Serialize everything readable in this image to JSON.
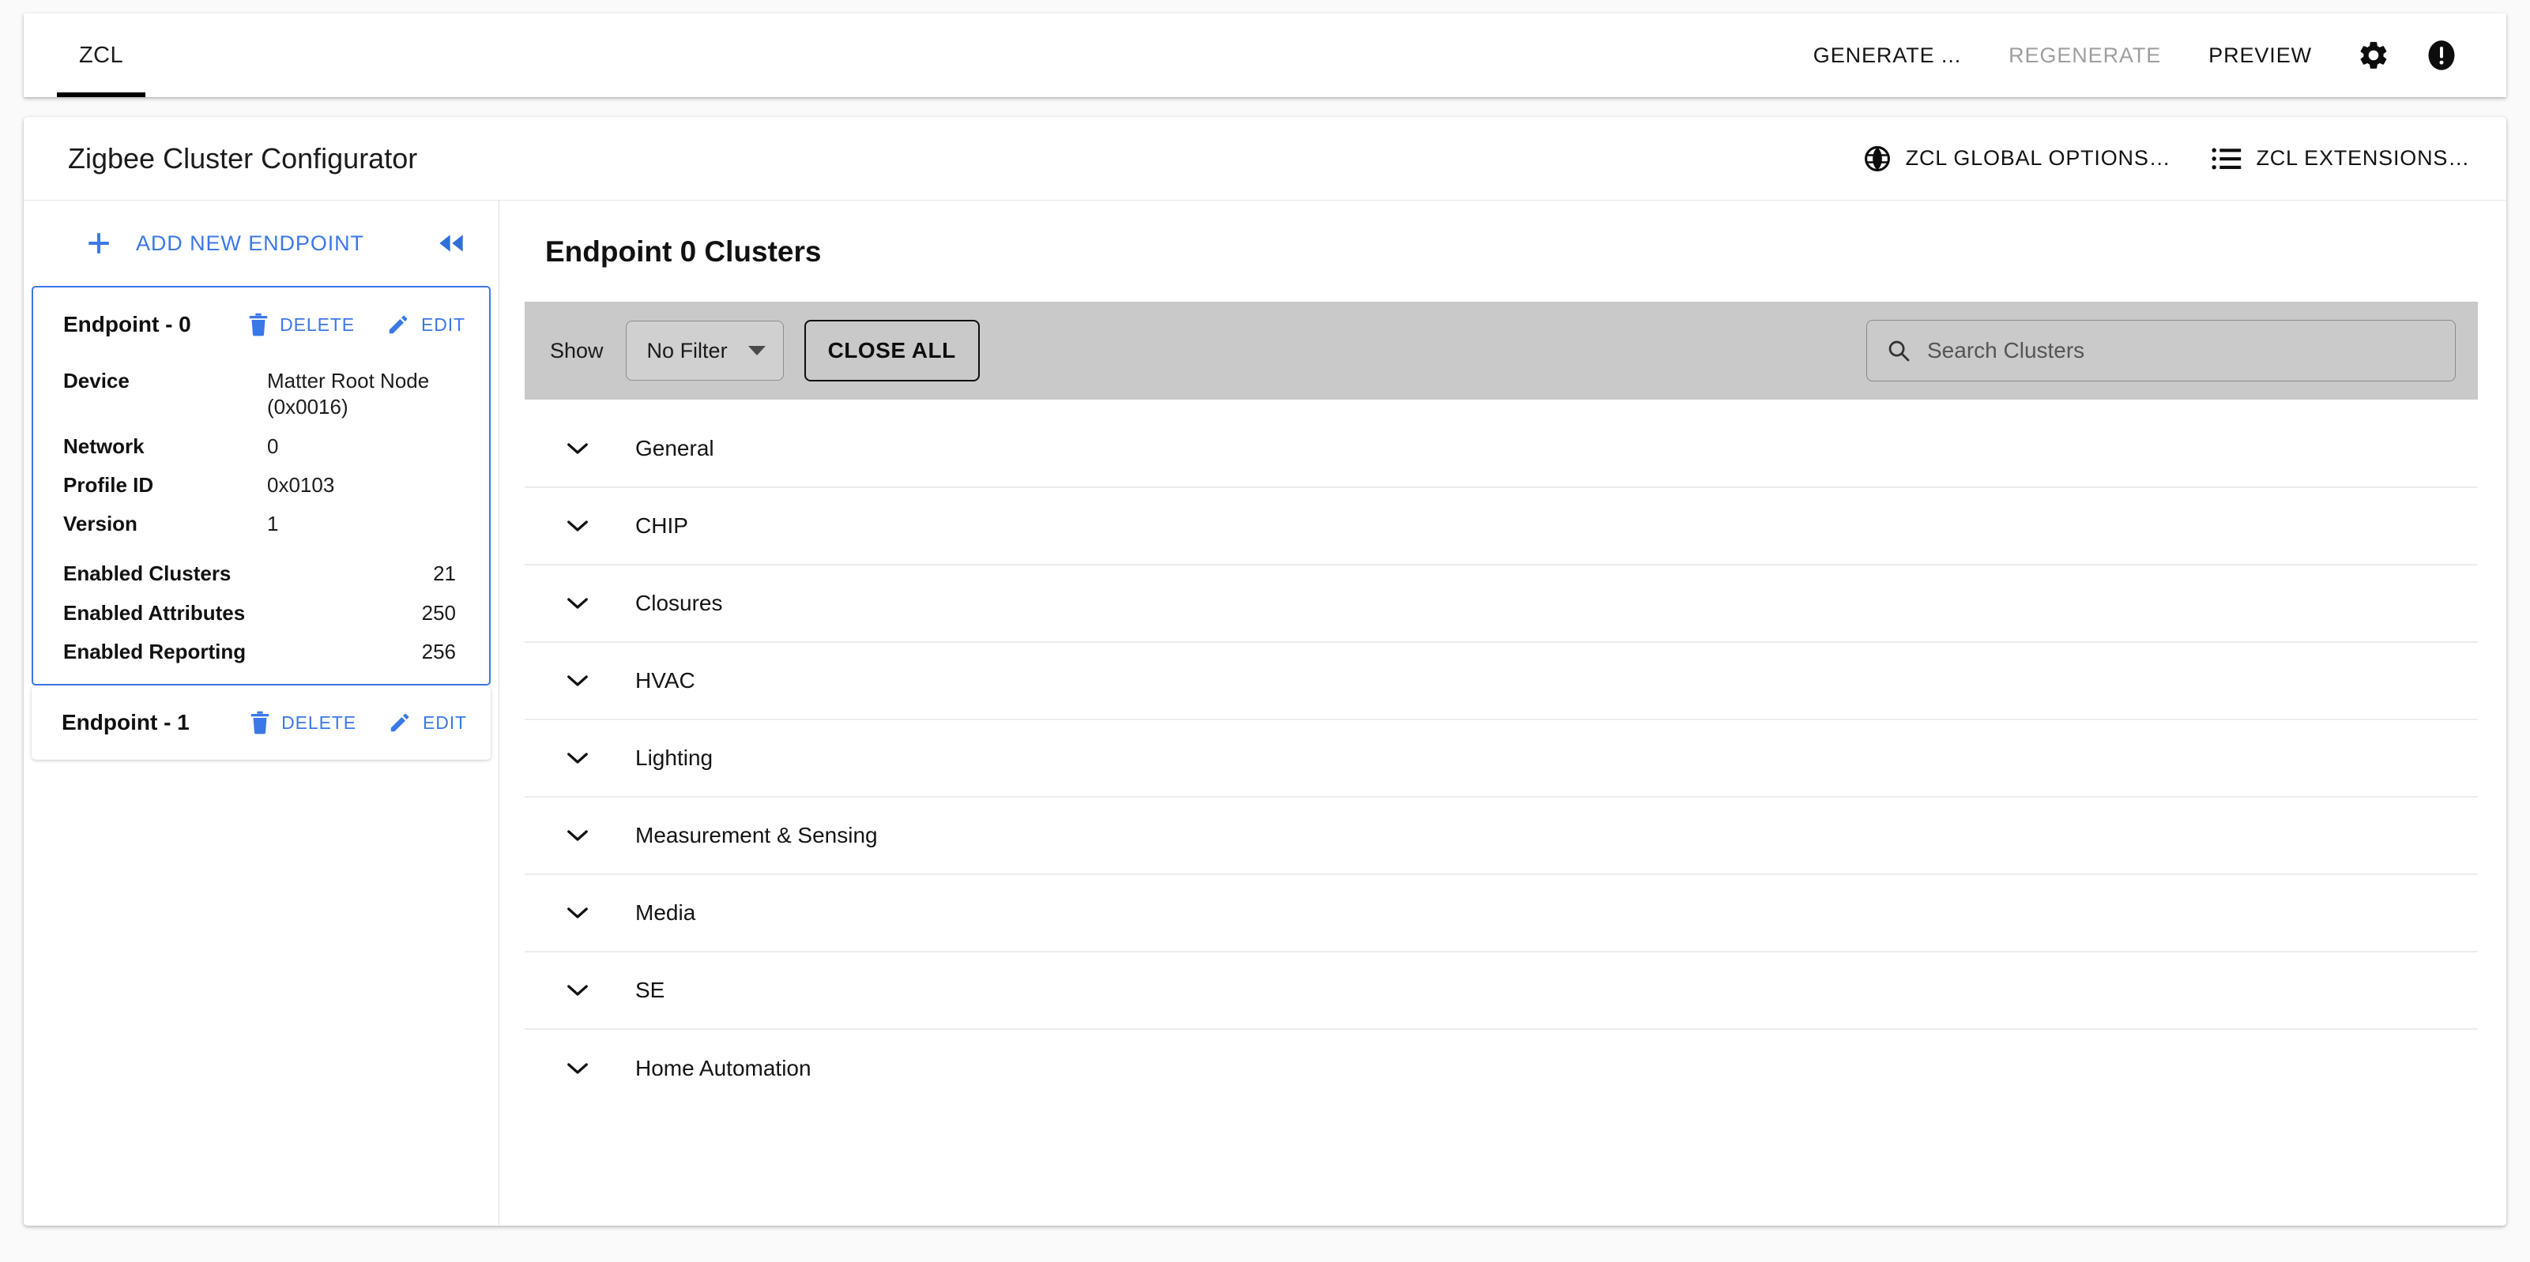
{
  "topbar": {
    "tabs": [
      {
        "label": "ZCL",
        "active": true
      }
    ],
    "actions": [
      {
        "label": "GENERATE ...",
        "disabled": false
      },
      {
        "label": "REGENERATE",
        "disabled": true
      },
      {
        "label": "PREVIEW",
        "disabled": false
      }
    ],
    "icons": [
      {
        "name": "gear-icon"
      },
      {
        "name": "alert-icon"
      }
    ]
  },
  "page_header": {
    "title": "Zigbee Cluster Configurator",
    "buttons": [
      {
        "label": "ZCL GLOBAL OPTIONS…",
        "icon": "globe-icon"
      },
      {
        "label": "ZCL EXTENSIONS…",
        "icon": "list-icon"
      }
    ]
  },
  "sidebar": {
    "add_endpoint_label": "ADD NEW ENDPOINT",
    "collapse_icon": "double-chevron-left-icon",
    "endpoints": [
      {
        "title": "Endpoint - 0",
        "selected": true,
        "delete_label": "DELETE",
        "edit_label": "EDIT",
        "details": [
          {
            "key": "Device",
            "value": "Matter Root Node (0x0016)",
            "align": "left"
          },
          {
            "key": "Network",
            "value": "0",
            "align": "left"
          },
          {
            "key": "Profile ID",
            "value": "0x0103",
            "align": "left"
          },
          {
            "key": "Version",
            "value": "1",
            "align": "left"
          },
          {
            "key": "Enabled Clusters",
            "value": "21",
            "align": "right"
          },
          {
            "key": "Enabled Attributes",
            "value": "250",
            "align": "right"
          },
          {
            "key": "Enabled Reporting",
            "value": "256",
            "align": "right"
          }
        ]
      },
      {
        "title": "Endpoint - 1",
        "selected": false,
        "delete_label": "DELETE",
        "edit_label": "EDIT",
        "details": []
      }
    ]
  },
  "main": {
    "title": "Endpoint 0 Clusters",
    "toolbar": {
      "show_label": "Show",
      "filter_value": "No Filter",
      "close_all_label": "CLOSE ALL",
      "search_placeholder": "Search Clusters",
      "search_value": ""
    },
    "clusters": [
      {
        "label": "General"
      },
      {
        "label": "CHIP"
      },
      {
        "label": "Closures"
      },
      {
        "label": "HVAC"
      },
      {
        "label": "Lighting"
      },
      {
        "label": "Measurement & Sensing"
      },
      {
        "label": "Media"
      },
      {
        "label": "SE"
      },
      {
        "label": "Home Automation"
      }
    ]
  },
  "colors": {
    "accent_blue": "#3b78e7",
    "toolbar_grey": "#c9c9c9",
    "text_dark": "#141414",
    "disabled_grey": "#9e9e9e"
  }
}
